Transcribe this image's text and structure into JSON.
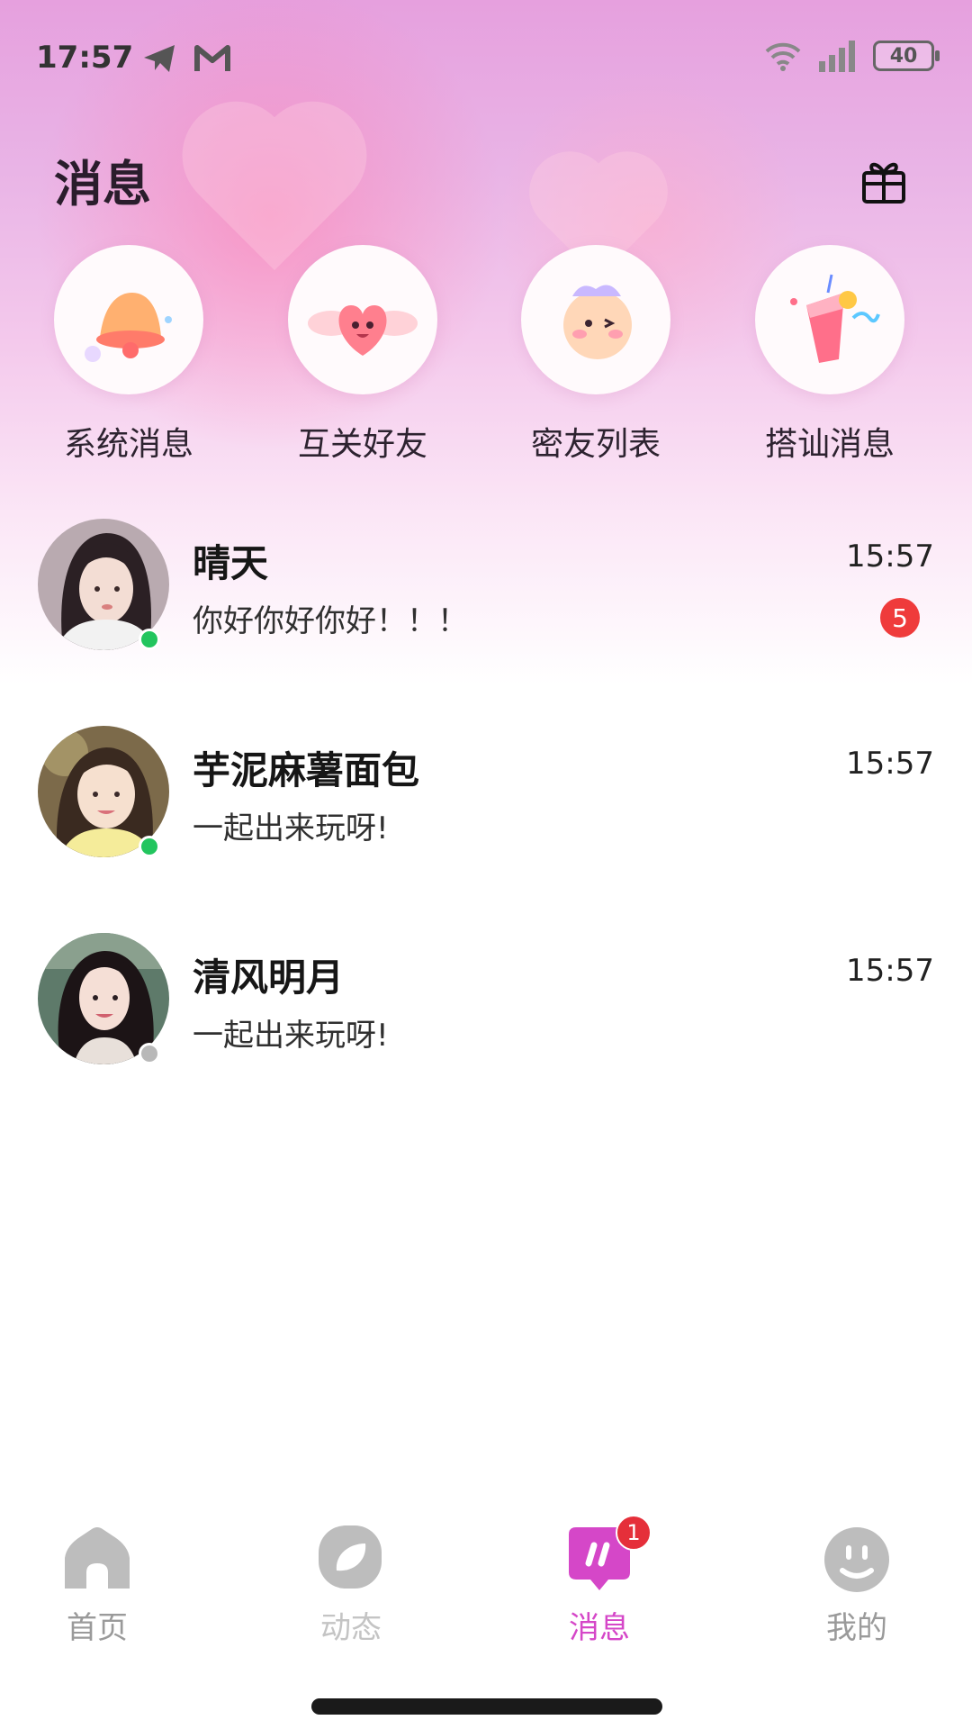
{
  "status_bar": {
    "time": "17:57",
    "left_icons": [
      "telegram-icon",
      "gmail-icon"
    ],
    "right_icons": [
      "wifi-icon",
      "signal-icon"
    ],
    "battery": "40"
  },
  "header": {
    "title": "消息",
    "action_icon": "gift-box-icon"
  },
  "quick_actions": [
    {
      "label": "系统消息",
      "icon": "bell-icon"
    },
    {
      "label": "互关好友",
      "icon": "winged-heart-icon"
    },
    {
      "label": "密友列表",
      "icon": "cute-face-icon"
    },
    {
      "label": "搭讪消息",
      "icon": "party-cup-icon"
    }
  ],
  "chats": [
    {
      "name": "晴天",
      "message": "你好你好你好！！！",
      "time": "15:57",
      "unread": "5",
      "online": true
    },
    {
      "name": "芋泥麻薯面包",
      "message": "一起出来玩呀!",
      "time": "15:57",
      "unread": "",
      "online": true
    },
    {
      "name": "清风明月",
      "message": "一起出来玩呀!",
      "time": "15:57",
      "unread": "",
      "online": false
    }
  ],
  "tab_bar": {
    "tabs": [
      {
        "label": "首页",
        "icon": "home-icon",
        "active": false
      },
      {
        "label": "动态",
        "icon": "feed-icon",
        "active": false
      },
      {
        "label": "消息",
        "icon": "message-icon",
        "active": true,
        "badge": "1"
      },
      {
        "label": "我的",
        "icon": "profile-icon",
        "active": false
      }
    ]
  },
  "colors": {
    "accent": "#d547c8",
    "badge": "#ef3b3b",
    "online": "#22c55e",
    "offline": "#b8b8b8",
    "inactive_tab": "#9a9a9a"
  }
}
